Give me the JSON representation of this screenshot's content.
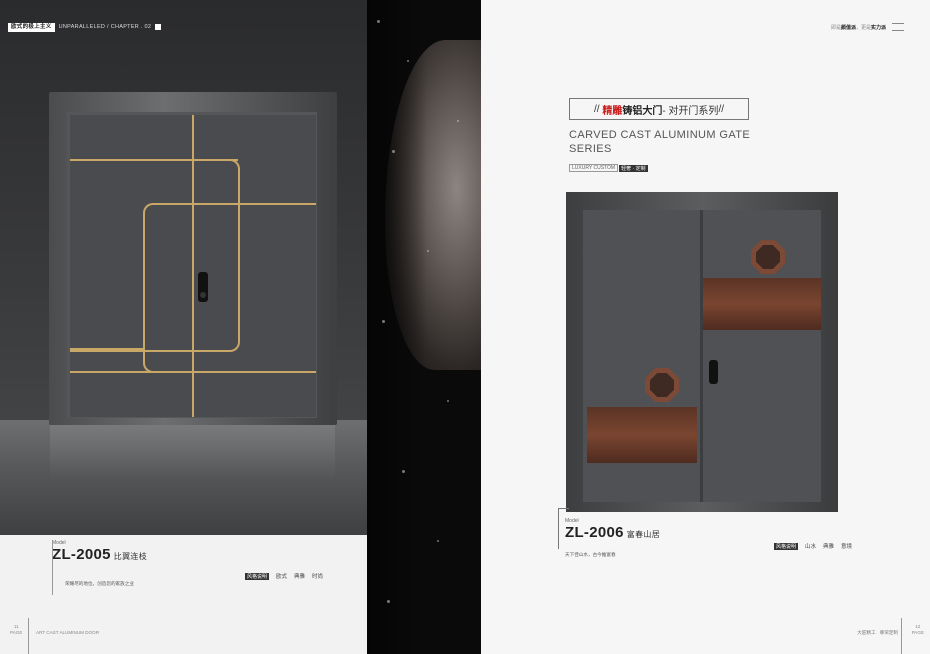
{
  "left_page": {
    "tag_label": "欧式的极上主义",
    "tag_text": "UNPARALLELED / CHAPTER . 02",
    "model_prefix": "Model",
    "model_number": "ZL-2005",
    "model_name": "比翼连枝",
    "caption": "荣耀尽的地位，创造您的家族之业",
    "style_label": "风格说明",
    "styles": [
      "欧式",
      "典雅",
      "时尚"
    ],
    "footer_page_no": "11",
    "footer_page_word": "PAGE",
    "footer_text": "ART CAST ALUMINUM DOOR"
  },
  "right_page": {
    "top_prefix": "即是",
    "top_bold1": "颜值派",
    "top_mid": "，更是",
    "top_bold2": "实力派",
    "title_slashes_open": "//",
    "title_red": "精雕",
    "title_dark": "铸铝大门",
    "title_rest": " - 对开门系列 ",
    "title_slashes_close": "//",
    "title_en": "CARVED CAST ALUMINUM GATE SERIES",
    "lux_text": "LUXURY CUSTOM",
    "lux_tag": "轻奢 · 定制",
    "model_prefix": "Model",
    "model_number": "ZL-2006",
    "model_name": "富春山居",
    "caption": "天下佳山水，古今推富春",
    "style_label": "风格说明",
    "styles": [
      "山水",
      "典雅",
      "意境"
    ],
    "footer_items": [
      "大匠精工",
      "尊荣定制"
    ],
    "footer_page_no": "12",
    "footer_page_word": "PAGE"
  },
  "colors": {
    "gold_inlay": "#c9a766",
    "copper_panel": "#7a4530",
    "accent_red": "#c81e1e"
  }
}
